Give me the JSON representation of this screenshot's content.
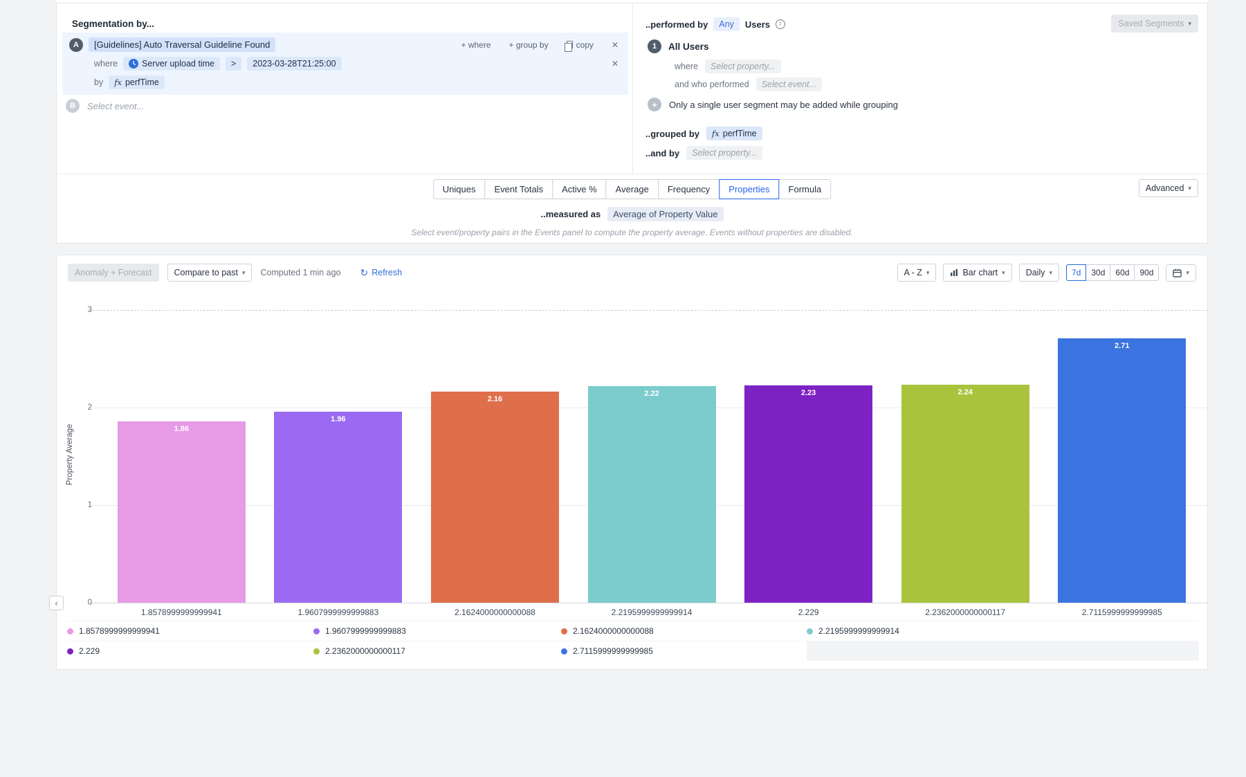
{
  "colors": {
    "accent": "#2563eb"
  },
  "icons": {
    "chevron_down": "▾",
    "chevron_left": "‹",
    "close": "✕",
    "info_letter": "i",
    "refresh": "↻",
    "plus_badge": "+",
    "fx": "fx"
  },
  "segmentation": {
    "title": "Segmentation by...",
    "event_a": {
      "badge": "A",
      "name": "[Guidelines] Auto Traversal Guideline Found",
      "add_where": "+ where",
      "add_group_by": "+ group by",
      "copy": "copy",
      "where_label": "where",
      "where_property": "Server upload time",
      "where_operator": ">",
      "where_value": "2023-03-28T21:25:00",
      "by_label": "by",
      "by_property": "perfTime"
    },
    "event_b": {
      "badge": "B",
      "placeholder": "Select event..."
    }
  },
  "audience": {
    "performed_by_label": "..performed by",
    "any_label": "Any",
    "users_label": "Users",
    "saved_segments_label": "Saved Segments",
    "segment_number": "1",
    "segment_name": "All Users",
    "where_label": "where",
    "where_placeholder": "Select property...",
    "performed_label": "and who performed",
    "performed_placeholder": "Select event...",
    "grouping_note": "Only a single user segment may be added while grouping",
    "grouped_by_label": "..grouped by",
    "grouped_by_property": "perfTime",
    "and_by_label": "..and by",
    "and_by_placeholder": "Select property..."
  },
  "measures": {
    "tabs": [
      "Uniques",
      "Event Totals",
      "Active %",
      "Average",
      "Frequency",
      "Properties",
      "Formula"
    ],
    "active_tab": "Properties",
    "advanced_label": "Advanced",
    "measured_as_label": "..measured as",
    "measured_as_value": "Average of Property Value",
    "note": "Select event/property pairs in the Events panel to compute the property average. Events without properties are disabled."
  },
  "toolbar": {
    "anomaly_forecast": "Anomaly + Forecast",
    "compare_to_past": "Compare to past",
    "computed": "Computed 1 min ago",
    "refresh": "Refresh",
    "sort": "A - Z",
    "chart_type": "Bar chart",
    "interval": "Daily",
    "ranges": [
      "7d",
      "30d",
      "60d",
      "90d"
    ],
    "active_range": "7d"
  },
  "chart_data": {
    "type": "bar",
    "title": "",
    "xlabel": "",
    "ylabel": "Property Average",
    "ylim": [
      0,
      3
    ],
    "yticks": [
      0,
      1,
      2,
      3
    ],
    "grid": true,
    "legend_position": "bottom",
    "categories": [
      "1.8578999999999941",
      "1.9607999999999883",
      "2.1624000000000088",
      "2.2195999999999914",
      "2.229",
      "2.2362000000000117",
      "2.7115999999999985"
    ],
    "values": [
      1.8579,
      1.9608,
      2.1624,
      2.2196,
      2.229,
      2.2362,
      2.7116
    ],
    "bar_labels": [
      "1.86",
      "1.96",
      "2.16",
      "2.22",
      "2.23",
      "2.24",
      "2.71"
    ],
    "colors": [
      "#e79ae5",
      "#9c6af2",
      "#df6f4a",
      "#7ccccd",
      "#7d22c3",
      "#a9c43c",
      "#3b74e0"
    ]
  }
}
